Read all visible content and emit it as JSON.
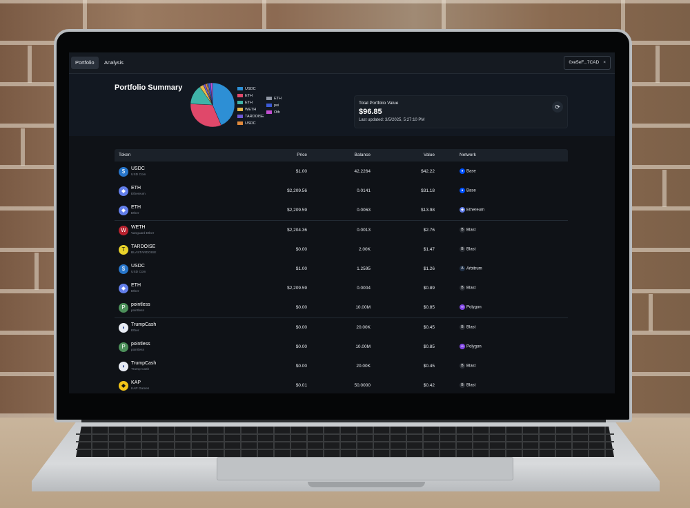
{
  "nav": {
    "tabs": [
      "Portfolio",
      "Analysis"
    ],
    "active_tab": "Portfolio",
    "wallet_address": "0xe5eF...7CAD",
    "wallet_close": "×"
  },
  "summary": {
    "title": "Portfolio Summary",
    "total_label": "Total Portfolio Value",
    "total_value": "$96.85",
    "last_updated": "Last updated: 3/5/2025, 5:27:10 PM",
    "refresh_icon": "refresh-icon"
  },
  "chart_data": {
    "type": "pie",
    "labels": [
      "USDC",
      "ETH",
      "ETH",
      "WETH",
      "TARDOISE",
      "USDC",
      "ETH",
      "pointless",
      "Other"
    ],
    "values": [
      42.22,
      31.18,
      13.98,
      2.76,
      1.47,
      1.26,
      0.89,
      1.7,
      1.39
    ],
    "colors": [
      "#2d8fd5",
      "#e0486a",
      "#3fb3a8",
      "#e6b94a",
      "#6e58d6",
      "#e08a3c",
      "#8f96a3",
      "#3c5bd6",
      "#c24fd1"
    ],
    "legend_visible": [
      "USDC",
      "ETH",
      "ETH",
      "WETH",
      "TARDOISE",
      "USDC",
      "ETH",
      "poi",
      "Oth"
    ]
  },
  "table": {
    "headers": [
      "Token",
      "Price",
      "Balance",
      "Value",
      "Network"
    ],
    "rows": [
      {
        "symbol": "USDC",
        "name": "USD Coin",
        "price": "$1.00",
        "balance": "42.2264",
        "value": "$42.22",
        "network": "Base",
        "icon": "usdc-icon",
        "icon_color": "#2775ca",
        "net_color": "#0052ff"
      },
      {
        "symbol": "ETH",
        "name": "Ethereum",
        "price": "$2,209.56",
        "balance": "0.0141",
        "value": "$31.18",
        "network": "Base",
        "icon": "eth-icon",
        "icon_color": "#627eea",
        "net_color": "#0052ff"
      },
      {
        "symbol": "ETH",
        "name": "Ether",
        "price": "$2,209.59",
        "balance": "0.0063",
        "value": "$13.98",
        "network": "Ethereum",
        "icon": "eth-icon",
        "icon_color": "#627eea",
        "net_color": "#627eea"
      },
      {
        "symbol": "WETH",
        "name": "Vanguard Ether",
        "price": "$2,204.36",
        "balance": "0.0013",
        "value": "$2.76",
        "network": "Blast",
        "icon": "weth-icon",
        "icon_color": "#b8212e",
        "net_color": "#2b2f36"
      },
      {
        "symbol": "TARDOISE",
        "name": "BLASTARDOISE",
        "price": "$0.00",
        "balance": "2.00K",
        "value": "$1.47",
        "network": "Blast",
        "icon": "tardoise-icon",
        "icon_color": "#e8d22a",
        "net_color": "#2b2f36"
      },
      {
        "symbol": "USDC",
        "name": "USD Coin",
        "price": "$1.00",
        "balance": "1.2595",
        "value": "$1.26",
        "network": "Arbitrum",
        "icon": "usdc-icon",
        "icon_color": "#2775ca",
        "net_color": "#213147"
      },
      {
        "symbol": "ETH",
        "name": "Ether",
        "price": "$2,209.59",
        "balance": "0.0004",
        "value": "$0.89",
        "network": "Blast",
        "icon": "eth-icon",
        "icon_color": "#627eea",
        "net_color": "#2b2f36"
      },
      {
        "symbol": "pointless",
        "name": "pointless",
        "price": "$0.00",
        "balance": "10.00M",
        "value": "$0.85",
        "network": "Polygon",
        "icon": "pointless-icon",
        "icon_color": "#4c8f5a",
        "net_color": "#8247e5"
      },
      {
        "symbol": "TrumpCash",
        "name": "Ether",
        "price": "$0.00",
        "balance": "20.00K",
        "value": "$0.45",
        "network": "Blast",
        "icon": "trumpcash-icon",
        "icon_color": "#e8ecf4",
        "net_color": "#2b2f36"
      },
      {
        "symbol": "pointless",
        "name": "pointless",
        "price": "$0.00",
        "balance": "10.00M",
        "value": "$0.85",
        "network": "Polygon",
        "icon": "pointless-icon",
        "icon_color": "#4c8f5a",
        "net_color": "#8247e5"
      },
      {
        "symbol": "TrumpCash",
        "name": "Trump Cash",
        "price": "$0.00",
        "balance": "20.00K",
        "value": "$0.45",
        "network": "Blast",
        "icon": "trumpcash-icon",
        "icon_color": "#e8ecf4",
        "net_color": "#2b2f36"
      },
      {
        "symbol": "KAP",
        "name": "KAP Games",
        "price": "$0.01",
        "balance": "50.0000",
        "value": "$0.42",
        "network": "Blast",
        "icon": "kap-icon",
        "icon_color": "#f2c418",
        "net_color": "#2b2f36"
      }
    ]
  }
}
